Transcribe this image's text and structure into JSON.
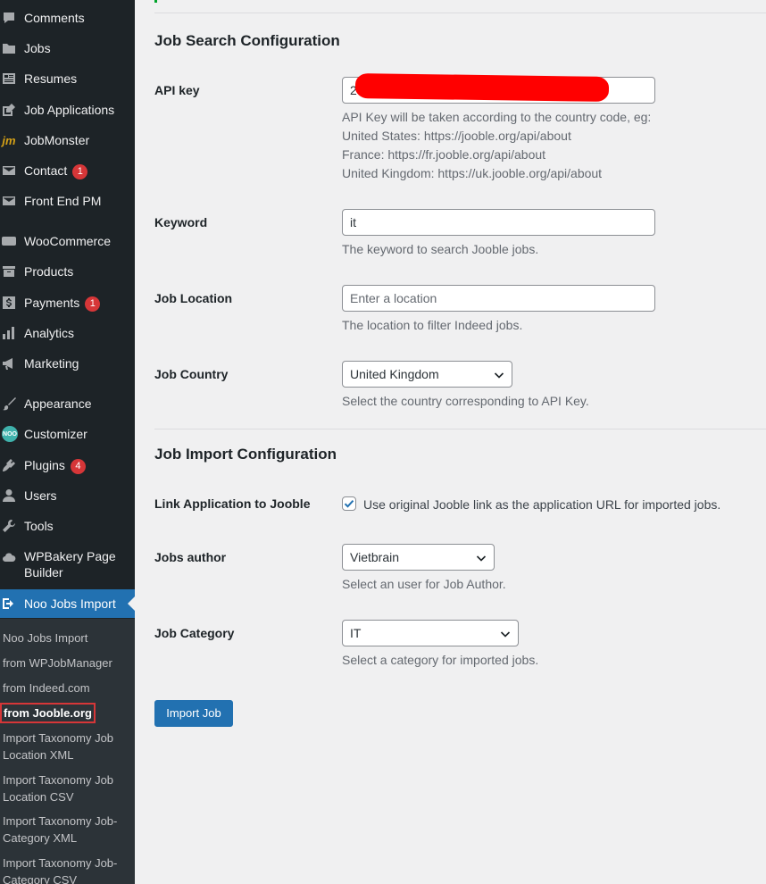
{
  "sidebar": {
    "menu": [
      {
        "label": "Comments",
        "icon": "comment-icon",
        "badge": ""
      },
      {
        "label": "Jobs",
        "icon": "folder-icon",
        "badge": ""
      },
      {
        "label": "Resumes",
        "icon": "resume-icon",
        "badge": ""
      },
      {
        "label": "Job Applications",
        "icon": "edit-icon",
        "badge": ""
      },
      {
        "label": "JobMonster",
        "icon": "jm-logo-icon",
        "badge": ""
      },
      {
        "label": "Contact",
        "icon": "mail-icon",
        "badge": "1"
      },
      {
        "label": "Front End PM",
        "icon": "mail-icon",
        "badge": ""
      },
      {
        "label": "WooCommerce",
        "icon": "woo-icon",
        "badge": ""
      },
      {
        "label": "Products",
        "icon": "archive-icon",
        "badge": ""
      },
      {
        "label": "Payments",
        "icon": "dollar-icon",
        "badge": "1"
      },
      {
        "label": "Analytics",
        "icon": "chart-bar-icon",
        "badge": ""
      },
      {
        "label": "Marketing",
        "icon": "megaphone-icon",
        "badge": ""
      },
      {
        "label": "Appearance",
        "icon": "brush-icon",
        "badge": ""
      },
      {
        "label": "Customizer",
        "icon": "noo-logo-icon",
        "badge": ""
      },
      {
        "label": "Plugins",
        "icon": "plugin-icon",
        "badge": "4"
      },
      {
        "label": "Users",
        "icon": "user-icon",
        "badge": ""
      },
      {
        "label": "Tools",
        "icon": "wrench-icon",
        "badge": ""
      },
      {
        "label": "WPBakery Page Builder",
        "icon": "cloud-icon",
        "badge": ""
      },
      {
        "label": "Noo Jobs Import",
        "icon": "import-icon",
        "badge": ""
      }
    ],
    "submenu": [
      "Noo Jobs Import",
      "from WPJobManager",
      "from Indeed.com",
      "from Jooble.org",
      "Import Taxonomy Job Location XML",
      "Import Taxonomy Job Location CSV",
      "Import Taxonomy Job-Category XML",
      "Import Taxonomy Job-Category CSV"
    ]
  },
  "search_config": {
    "title": "Job Search Configuration",
    "api_key": {
      "label": "API key",
      "value": "2",
      "desc_lines": [
        "API Key will be taken according to the country code, eg:",
        "United States: https://jooble.org/api/about",
        "France: https://fr.jooble.org/api/about",
        "United Kingdom: https://uk.jooble.org/api/about"
      ]
    },
    "keyword": {
      "label": "Keyword",
      "value": "it",
      "desc": "The keyword to search Jooble jobs."
    },
    "location": {
      "label": "Job Location",
      "placeholder": "Enter a location",
      "desc": "The location to filter Indeed jobs."
    },
    "country": {
      "label": "Job Country",
      "value": "United Kingdom",
      "desc": "Select the country corresponding to API Key."
    }
  },
  "import_config": {
    "title": "Job Import Configuration",
    "link": {
      "label": "Link Application to Jooble",
      "checked": true,
      "text": "Use original Jooble link as the application URL for imported jobs."
    },
    "author": {
      "label": "Jobs author",
      "value": "Vietbrain",
      "desc": "Select an user for Job Author."
    },
    "category": {
      "label": "Job Category",
      "value": "IT",
      "desc": "Select a category for imported jobs."
    },
    "button": "Import Job"
  },
  "colors": {
    "accent": "#2271b1",
    "sidebar": "#1d2327",
    "badge": "#d63638",
    "redaction": "#ff0000"
  }
}
